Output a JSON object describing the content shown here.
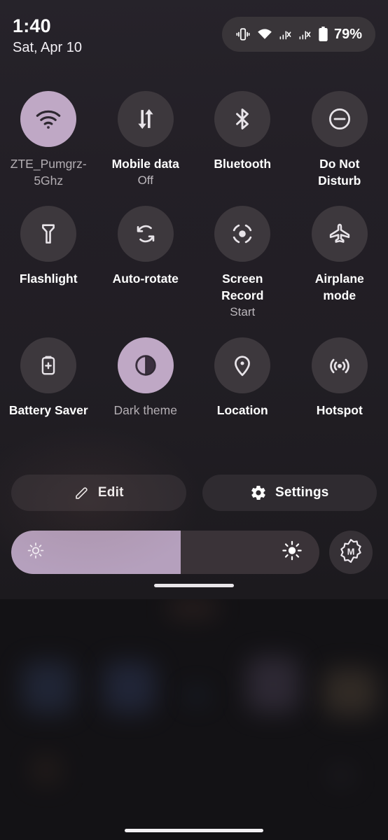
{
  "statusbar": {
    "time": "1:40",
    "date": "Sat, Apr 10",
    "battery_percent": "79%",
    "icons": [
      "vibrate-icon",
      "wifi-icon",
      "signal-no-sim-icon",
      "signal-no-sim-icon",
      "battery-icon"
    ]
  },
  "tiles": [
    {
      "id": "wifi",
      "icon": "wifi-icon",
      "label": "ZTE_Pumgrz-5Ghz",
      "sub": "",
      "active": true
    },
    {
      "id": "mobile-data",
      "icon": "mobile-data-icon",
      "label": "Mobile data",
      "sub": "Off",
      "active": false
    },
    {
      "id": "bluetooth",
      "icon": "bluetooth-icon",
      "label": "Bluetooth",
      "sub": "",
      "active": false
    },
    {
      "id": "dnd",
      "icon": "do-not-disturb-icon",
      "label": "Do Not Disturb",
      "sub": "",
      "active": false
    },
    {
      "id": "flashlight",
      "icon": "flashlight-icon",
      "label": "Flashlight",
      "sub": "",
      "active": false
    },
    {
      "id": "auto-rotate",
      "icon": "auto-rotate-icon",
      "label": "Auto-rotate",
      "sub": "",
      "active": false
    },
    {
      "id": "screen-record",
      "icon": "screen-record-icon",
      "label": "Screen Record",
      "sub": "Start",
      "active": false
    },
    {
      "id": "airplane",
      "icon": "airplane-icon",
      "label": "Airplane mode",
      "sub": "",
      "active": false
    },
    {
      "id": "battery-saver",
      "icon": "battery-saver-icon",
      "label": "Battery Saver",
      "sub": "",
      "active": false
    },
    {
      "id": "dark-theme",
      "icon": "dark-theme-icon",
      "label": "Dark theme",
      "sub": "",
      "active": true
    },
    {
      "id": "location",
      "icon": "location-pin-icon",
      "label": "Location",
      "sub": "",
      "active": false
    },
    {
      "id": "hotspot",
      "icon": "hotspot-icon",
      "label": "Hotspot",
      "sub": "",
      "active": false
    }
  ],
  "footer": {
    "edit_label": "Edit",
    "settings_label": "Settings"
  },
  "brightness": {
    "level_percent": 55,
    "left_icon": "brightness-low-icon",
    "right_icon": "brightness-high-icon",
    "auto_icon": "auto-brightness-m-icon"
  },
  "colors": {
    "accent_active": "#bfa8c5",
    "tile_inactive": "#3d383d",
    "panel_bg": "#231f26",
    "slider_fill": "#b5a0bd",
    "slider_track": "#3a3338"
  }
}
